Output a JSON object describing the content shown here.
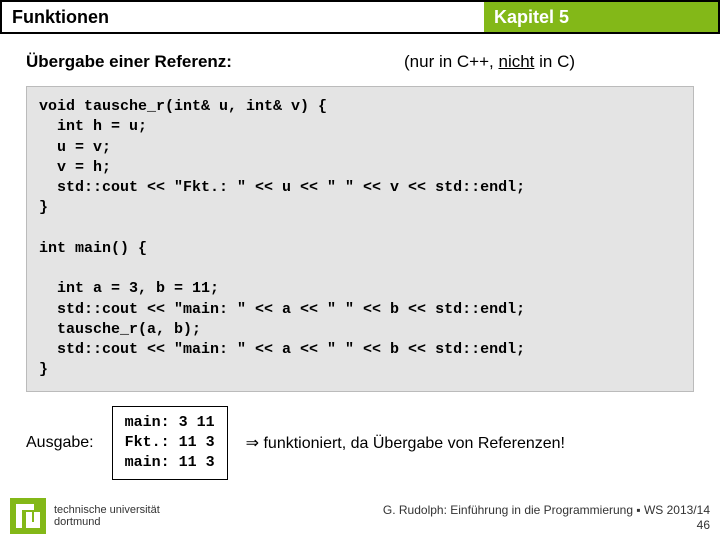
{
  "header": {
    "left": "Funktionen",
    "right": "Kapitel 5"
  },
  "subtitle": {
    "left": "Übergabe einer Referenz:",
    "right_prefix": "(nur in C++, ",
    "right_underlined": "nicht",
    "right_suffix": " in C)"
  },
  "code": "void tausche_r(int& u, int& v) {\n  int h = u;\n  u = v;\n  v = h;\n  std::cout << \"Fkt.: \" << u << \" \" << v << std::endl;\n}\n\nint main() {\n\n  int a = 3, b = 11;\n  std::cout << \"main: \" << a << \" \" << b << std::endl;\n  tausche_r(a, b);\n  std::cout << \"main: \" << a << \" \" << b << std::endl;\n}",
  "output": {
    "label": "Ausgabe:",
    "text": "main: 3 11\nFkt.: 11 3\nmain: 11 3"
  },
  "note": "⇒ funktioniert, da Übergabe von Referenzen!",
  "footer": {
    "line1": "G. Rudolph: Einführung in die Programmierung ▪ WS 2013/14",
    "line2": "46"
  },
  "logo": {
    "line1": "technische universität",
    "line2": "dortmund"
  }
}
